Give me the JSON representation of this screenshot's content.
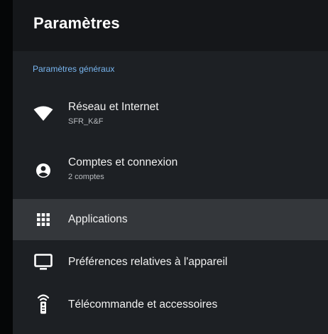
{
  "header": {
    "title": "Paramètres"
  },
  "section": {
    "label": "Paramètres généraux"
  },
  "items": [
    {
      "title": "Réseau et Internet",
      "subtitle": "SFR_K&F",
      "icon": "wifi-icon"
    },
    {
      "title": "Comptes et connexion",
      "subtitle": "2 comptes",
      "icon": "account-icon"
    },
    {
      "title": "Applications",
      "icon": "apps-grid-icon",
      "selected": true
    },
    {
      "title": "Préférences relatives à l'appareil",
      "icon": "tv-monitor-icon"
    },
    {
      "title": "Télécommande et accessoires",
      "icon": "remote-icon"
    }
  ],
  "colors": {
    "accent": "#79b7f2",
    "background": "#1d2024",
    "header": "#15171a",
    "selected": "#34373b"
  }
}
